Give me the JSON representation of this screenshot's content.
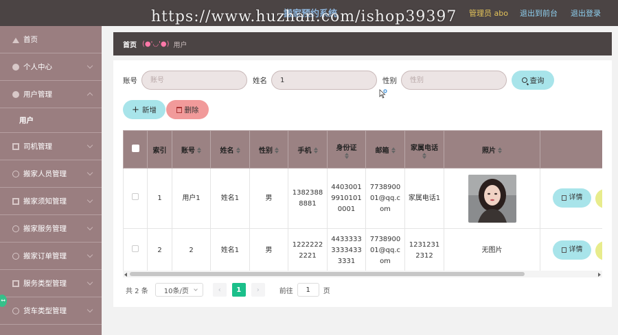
{
  "header": {
    "app_title": "搬家预约系统",
    "admin": "管理员 abo",
    "front_link": "退出到前台",
    "logout_link": "退出登录",
    "watermark": "https://www.huzhan.com/ishop39397"
  },
  "sidebar": {
    "items": [
      {
        "label": "首页",
        "icon": "home-icon"
      },
      {
        "label": "个人中心",
        "icon": "user-icon"
      },
      {
        "label": "用户管理",
        "icon": "user-icon"
      },
      {
        "label": "司机管理",
        "icon": "grid-icon"
      },
      {
        "label": "搬家人员管理",
        "icon": "circle-icon"
      },
      {
        "label": "搬家须知管理",
        "icon": "grid-icon"
      },
      {
        "label": "搬家服务管理",
        "icon": "circle-icon"
      },
      {
        "label": "搬家订单管理",
        "icon": "circle-icon"
      },
      {
        "label": "服务类型管理",
        "icon": "grid-icon"
      },
      {
        "label": "货车类型管理",
        "icon": "circle-icon"
      }
    ],
    "sub_item": "用户"
  },
  "breadcrumb": {
    "home": "首页",
    "face": "(●'◡'●)",
    "current": "用户"
  },
  "search": {
    "account_label": "账号",
    "account_placeholder": "账号",
    "account_value": "",
    "name_label": "姓名",
    "name_value": "1",
    "gender_label": "性别",
    "gender_placeholder": "性别",
    "search_button": "查询"
  },
  "actions": {
    "add": "新增",
    "delete": "删除"
  },
  "table": {
    "headers": [
      "索引",
      "账号",
      "姓名",
      "性别",
      "手机",
      "身份证",
      "邮箱",
      "家属电话",
      "照片"
    ],
    "rows": [
      {
        "index": "1",
        "account": "用户1",
        "name": "姓名1",
        "gender": "男",
        "phone": "13823888881",
        "id_card": "440300199101010001",
        "email": "773890001@qq.com",
        "family_phone": "家属电话1",
        "photo": "",
        "detail": "详情"
      },
      {
        "index": "2",
        "account": "2",
        "name": "姓名1",
        "gender": "男",
        "phone": "12222222221",
        "id_card": "443333333334333331",
        "email": "773890001@qq.com",
        "family_phone": "12312312312",
        "photo": "无图片",
        "detail": "详情"
      }
    ]
  },
  "pagination": {
    "total": "共 2 条",
    "page_size": "10条/页",
    "current_page": "1",
    "goto_label": "前往",
    "goto_value": "1",
    "page_suffix": "页"
  },
  "colors": {
    "topbar": "#4b4444",
    "sidebar": "#9a7e80",
    "accent_cyan": "#a8e4ea",
    "danger_pink": "#f19a9a",
    "table_header": "#9b8283",
    "page_active": "#1bbf8a"
  }
}
